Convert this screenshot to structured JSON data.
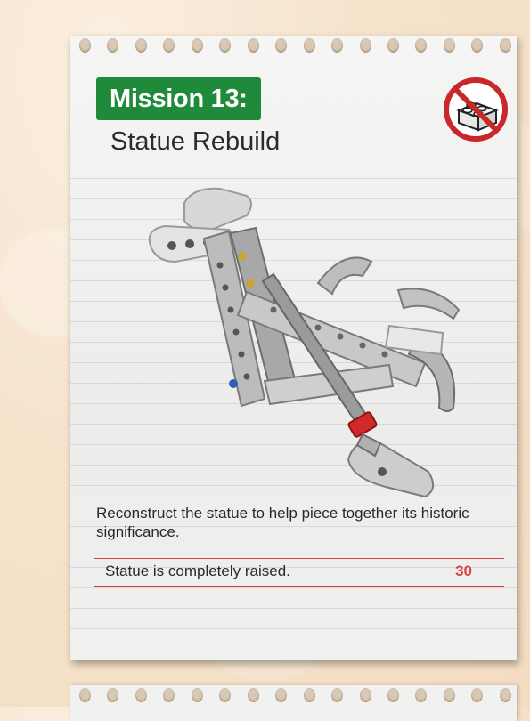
{
  "mission": {
    "badge": "Mission 13:",
    "title": "Statue Rebuild"
  },
  "icons": {
    "no_brick": "no-lego-brick-icon"
  },
  "description": "Reconstruct the statue to help piece together its historic significance.",
  "scoring": [
    {
      "label": "Statue is completely raised.",
      "points": "30"
    }
  ],
  "colors": {
    "badge": "#1e8a3a",
    "accent_red": "#d6463f",
    "paper": "#f0f0ef",
    "background": "#f6e3cc"
  }
}
